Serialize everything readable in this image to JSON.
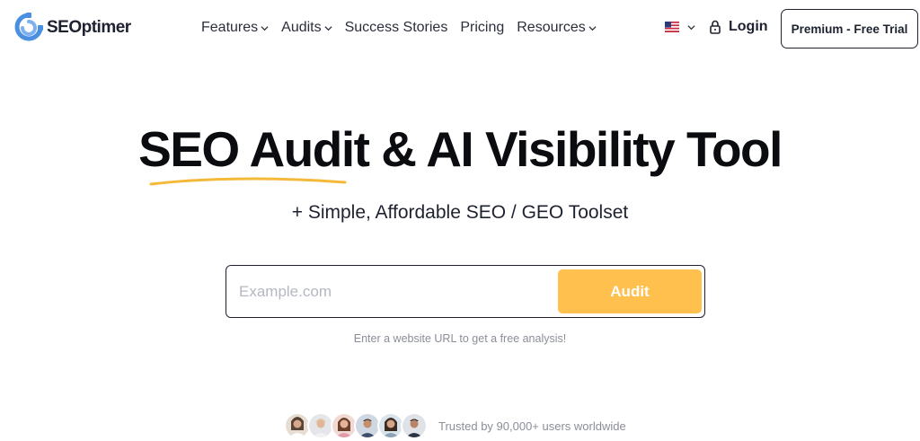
{
  "brand": {
    "name": "SEOptimer",
    "colors": {
      "blue": "#4a8fe0",
      "dark": "#1e2230",
      "accent": "#ffc04d",
      "muted": "#8a8e98"
    }
  },
  "nav": {
    "items": [
      {
        "label": "Features",
        "dropdown": true
      },
      {
        "label": "Audits",
        "dropdown": true
      },
      {
        "label": "Success Stories",
        "dropdown": false
      },
      {
        "label": "Pricing",
        "dropdown": false
      },
      {
        "label": "Resources",
        "dropdown": true
      }
    ],
    "language_icon": "us-flag-icon",
    "login_label": "Login",
    "premium_label": "Premium - Free Trial"
  },
  "hero": {
    "title": "SEO Audit & AI Visibility Tool",
    "subtitle": "+ Simple, Affordable SEO / GEO Toolset"
  },
  "search": {
    "placeholder": "Example.com",
    "value": "",
    "button_label": "Audit",
    "hint": "Enter a website URL to get a free analysis!"
  },
  "trust": {
    "text": "Trusted by 90,000+ users worldwide",
    "avatar_count": 6
  }
}
